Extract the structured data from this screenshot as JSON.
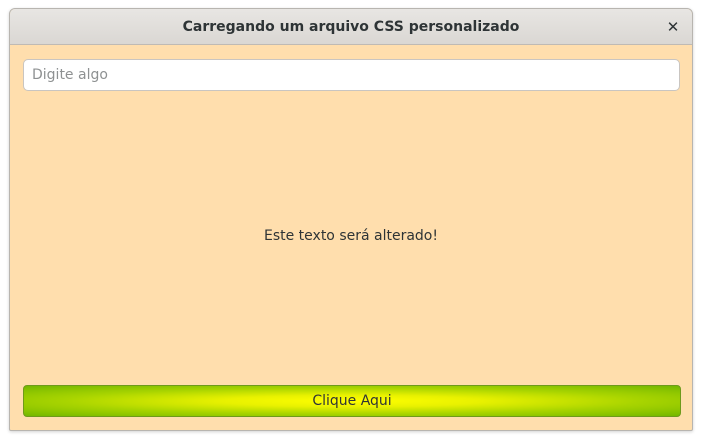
{
  "window": {
    "title": "Carregando um arquivo CSS personalizado",
    "close_glyph": "✕"
  },
  "entry": {
    "placeholder": "Digite algo",
    "value": ""
  },
  "label": {
    "text": "Este texto será alterado!"
  },
  "button": {
    "label": "Clique Aqui"
  },
  "colors": {
    "window_background": "#ffdead",
    "button_center": "#ffff00",
    "button_edge": "#73b700"
  }
}
